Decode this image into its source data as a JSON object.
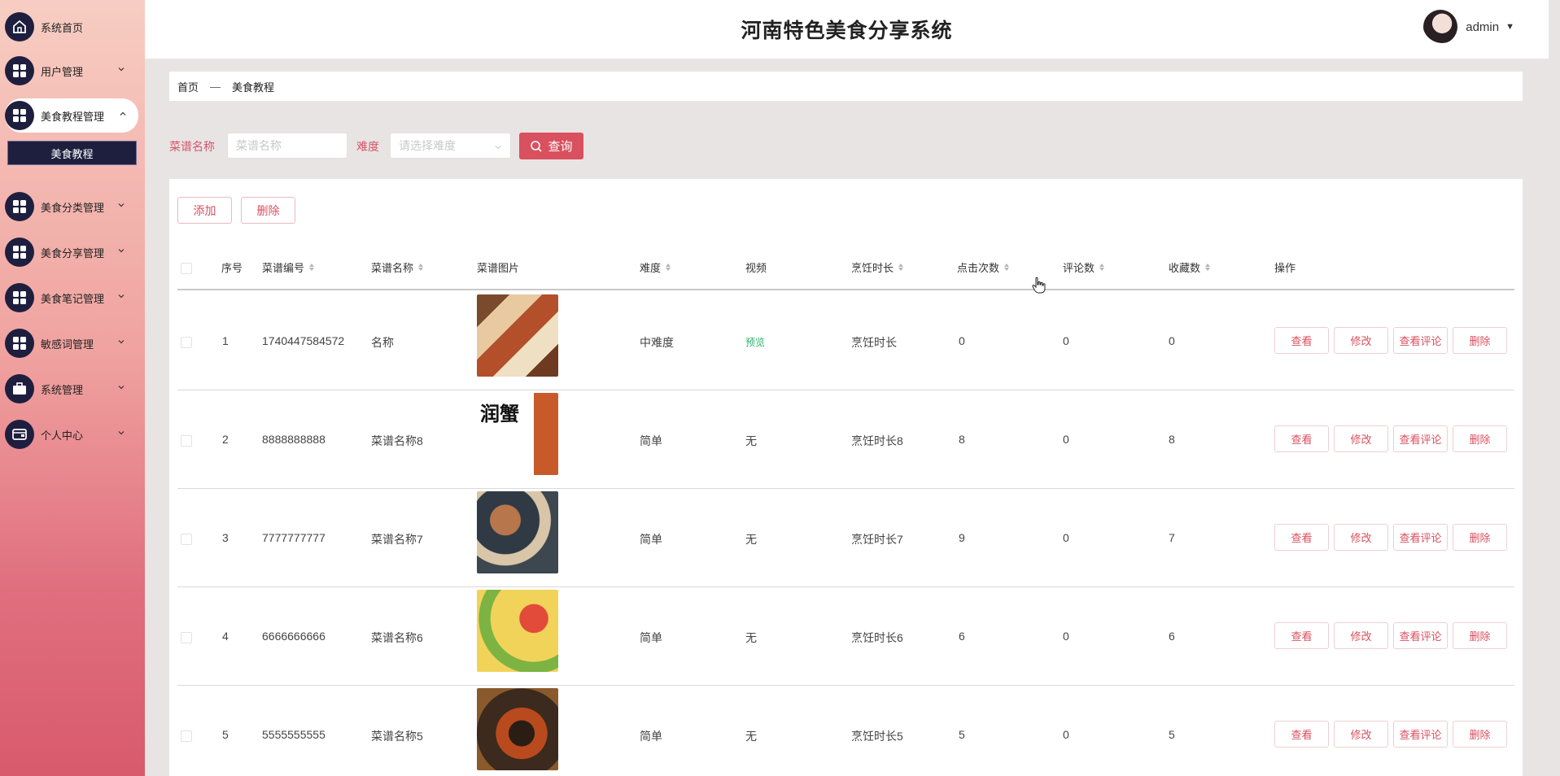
{
  "app": {
    "title": "河南特色美食分享系统",
    "user": "admin"
  },
  "sidebar": {
    "items": [
      {
        "label": "系统首页",
        "icon": "home-icon"
      },
      {
        "label": "用户管理",
        "icon": "grid-icon"
      },
      {
        "label": "美食教程管理",
        "icon": "grid-icon"
      },
      {
        "label": "美食分类管理",
        "icon": "grid-icon"
      },
      {
        "label": "美食分享管理",
        "icon": "grid-icon"
      },
      {
        "label": "美食笔记管理",
        "icon": "grid-icon"
      },
      {
        "label": "敏感词管理",
        "icon": "grid-icon"
      },
      {
        "label": "系统管理",
        "icon": "briefcase-icon"
      },
      {
        "label": "个人中心",
        "icon": "wallet-icon"
      }
    ],
    "subitem": "美食教程"
  },
  "breadcrumb": {
    "home": "首页",
    "sep": "—",
    "current": "美食教程"
  },
  "search": {
    "name_label": "菜谱名称",
    "name_placeholder": "菜谱名称",
    "difficulty_label": "难度",
    "difficulty_placeholder": "请选择难度",
    "button": "查询"
  },
  "toolbar": {
    "add": "添加",
    "delete": "删除"
  },
  "table": {
    "headers": {
      "index": "序号",
      "code": "菜谱编号",
      "name": "菜谱名称",
      "image": "菜谱图片",
      "difficulty": "难度",
      "video": "视频",
      "duration": "烹饪时长",
      "clicks": "点击次数",
      "comments": "评论数",
      "favorites": "收藏数",
      "actions": "操作"
    },
    "rows": [
      {
        "index": "1",
        "code": "1740447584572",
        "name": "名称",
        "difficulty": "中难度",
        "video": "预览",
        "duration": "烹饪时长",
        "clicks": "0",
        "comments": "0",
        "favorites": "0"
      },
      {
        "index": "2",
        "code": "8888888888",
        "name": "菜谱名称8",
        "difficulty": "简单",
        "video": "无",
        "duration": "烹饪时长8",
        "clicks": "8",
        "comments": "0",
        "favorites": "8"
      },
      {
        "index": "3",
        "code": "7777777777",
        "name": "菜谱名称7",
        "difficulty": "简单",
        "video": "无",
        "duration": "烹饪时长7",
        "clicks": "9",
        "comments": "0",
        "favorites": "7"
      },
      {
        "index": "4",
        "code": "6666666666",
        "name": "菜谱名称6",
        "difficulty": "简单",
        "video": "无",
        "duration": "烹饪时长6",
        "clicks": "6",
        "comments": "0",
        "favorites": "6"
      },
      {
        "index": "5",
        "code": "5555555555",
        "name": "菜谱名称5",
        "difficulty": "简单",
        "video": "无",
        "duration": "烹饪时长5",
        "clicks": "5",
        "comments": "0",
        "favorites": "5"
      }
    ],
    "actions": {
      "view": "查看",
      "edit": "修改",
      "view_comments": "查看评论",
      "delete": "删除"
    }
  },
  "image_overlay": {
    "row2_title": "润蟹"
  },
  "colors": {
    "accent": "#d9505f",
    "nav_dark": "#1e1f3f",
    "video_link": "#2cb36b"
  }
}
